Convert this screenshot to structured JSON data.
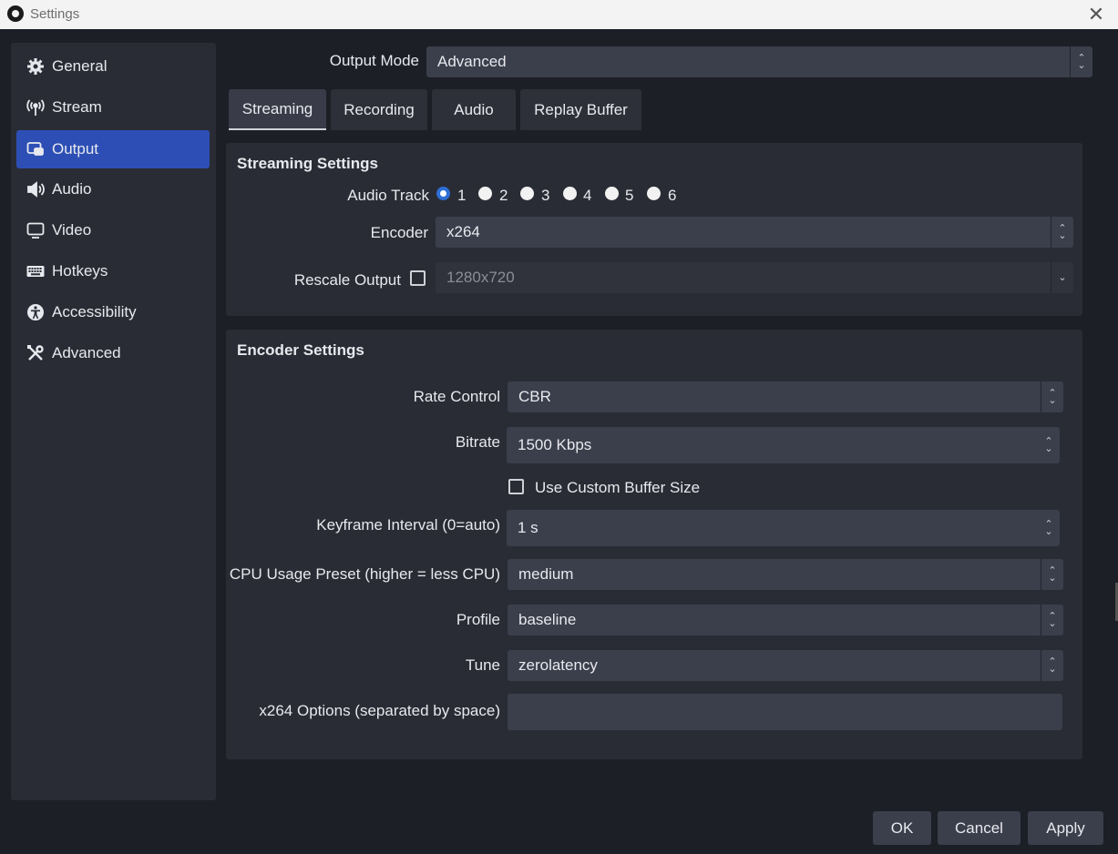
{
  "window": {
    "title": "Settings",
    "close_glyph": "✕"
  },
  "sidebar": {
    "items": [
      {
        "label": "General",
        "icon": "gear-icon"
      },
      {
        "label": "Stream",
        "icon": "broadcast-icon"
      },
      {
        "label": "Output",
        "icon": "output-icon",
        "active": true
      },
      {
        "label": "Audio",
        "icon": "speaker-icon"
      },
      {
        "label": "Video",
        "icon": "monitor-icon"
      },
      {
        "label": "Hotkeys",
        "icon": "keyboard-icon"
      },
      {
        "label": "Accessibility",
        "icon": "accessibility-icon"
      },
      {
        "label": "Advanced",
        "icon": "tools-icon"
      }
    ]
  },
  "output_mode": {
    "label": "Output Mode",
    "value": "Advanced"
  },
  "tabs": [
    {
      "label": "Streaming",
      "active": true
    },
    {
      "label": "Recording"
    },
    {
      "label": "Audio"
    },
    {
      "label": "Replay Buffer"
    }
  ],
  "streaming_settings": {
    "title": "Streaming Settings",
    "audio_track": {
      "label": "Audio Track",
      "options": [
        "1",
        "2",
        "3",
        "4",
        "5",
        "6"
      ],
      "selected": "1"
    },
    "encoder": {
      "label": "Encoder",
      "value": "x264"
    },
    "rescale": {
      "label": "Rescale Output",
      "checked": false,
      "value": "1280x720"
    }
  },
  "encoder_settings": {
    "title": "Encoder Settings",
    "rate_control": {
      "label": "Rate Control",
      "value": "CBR"
    },
    "bitrate": {
      "label": "Bitrate",
      "value": "1500 Kbps"
    },
    "custom_buffer": {
      "label": "Use Custom Buffer Size",
      "checked": false
    },
    "keyframe": {
      "label": "Keyframe Interval (0=auto)",
      "value": "1 s"
    },
    "cpu_preset": {
      "label": "CPU Usage Preset (higher = less CPU)",
      "value": "medium"
    },
    "profile": {
      "label": "Profile",
      "value": "baseline"
    },
    "tune": {
      "label": "Tune",
      "value": "zerolatency"
    },
    "x264_options": {
      "label": "x264 Options (separated by space)",
      "value": ""
    }
  },
  "buttons": {
    "ok": "OK",
    "cancel": "Cancel",
    "apply": "Apply"
  },
  "colors": {
    "accent": "#2d4fb5",
    "background": "#1d1f26",
    "panel": "#2a2c35",
    "field": "#3b3e4b"
  }
}
